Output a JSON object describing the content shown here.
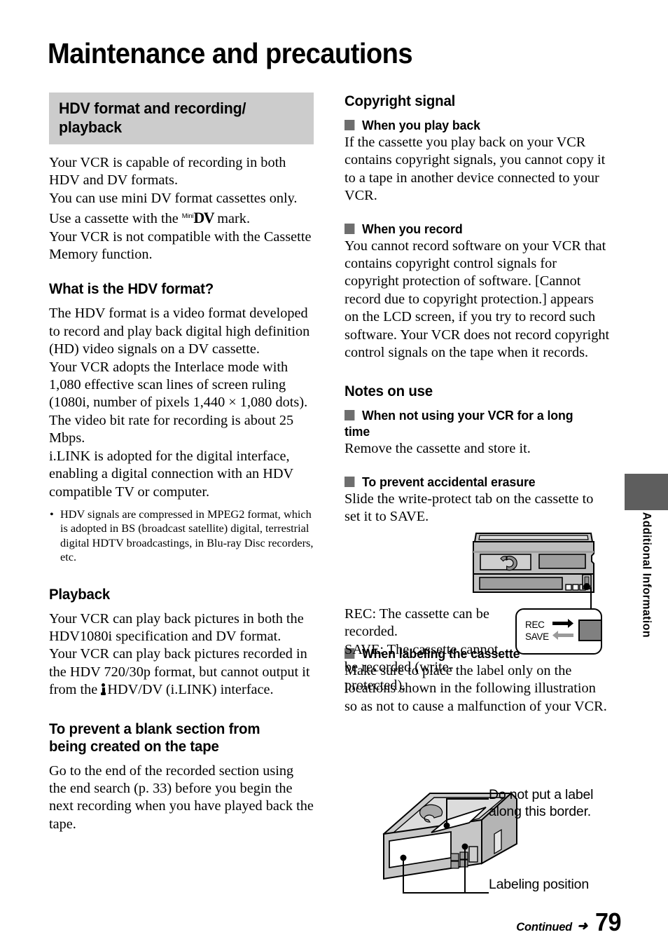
{
  "page": {
    "title": "Maintenance and precautions",
    "number": "79",
    "continued_label": "Continued",
    "continued_arrow": "➜",
    "side_tab_label": "Additional Information"
  },
  "colors": {
    "band_background": "#cccccc",
    "bullet_square": "#6e6e6e",
    "side_tab": "#5e5e5e",
    "cassette_body": "#b8b8b8",
    "cassette_light": "#d6d6d6",
    "cassette_dark": "#9a9a9a",
    "tab_gray": "#808080"
  },
  "left_column": {
    "band_heading": "HDV format and recording/ playback",
    "intro": {
      "line1": "Your VCR is capable of recording in both HDV and DV formats.",
      "line2": "You can use mini DV format cassettes only.",
      "line3_before": "Use a cassette with the ",
      "mini_mark_small": "Mini",
      "mini_mark_big": "DV",
      "line3_after": " mark.",
      "line4": "Your VCR is not compatible with the Cassette Memory function."
    },
    "sections": [
      {
        "heading": "What is the HDV format?",
        "paragraphs": [
          "The HDV format is a video format developed to record and play back digital high definition (HD) video signals on a DV cassette.",
          "Your VCR adopts the Interlace mode with 1,080 effective scan lines of screen ruling (1080i, number of pixels 1,440 × 1,080 dots).",
          "The video bit rate for recording is about 25 Mbps.",
          "i.LINK is adopted for the digital interface, enabling a digital connection with an HDV compatible TV or computer."
        ],
        "bullets": [
          "HDV signals are compressed in MPEG2 format, which is adopted in BS (broadcast satellite) digital, terrestrial digital HDTV broadcastings, in Blu-ray Disc recorders, etc."
        ]
      },
      {
        "heading": "Playback",
        "paragraphs": [
          "Your VCR can play back pictures in both the HDV1080i specification and DV format."
        ],
        "ilink_paragraph": {
          "before": "Your VCR can play back pictures recorded in the HDV 720/30p format, but cannot output it from the ",
          "icon": "ilink-icon",
          "after": "HDV/DV (i.LINK) interface."
        }
      },
      {
        "heading": "To prevent a blank section from being created on the tape",
        "paragraphs": [
          "Go to the end of the recorded section using the end search (p. 33) before you begin the next recording when you have played back the tape."
        ]
      }
    ]
  },
  "right_column": {
    "sections": [
      {
        "heading": "Copyright signal",
        "subsections": [
          {
            "heading": "When you play back",
            "paragraph": "If the cassette you play back on your VCR contains copyright signals, you cannot copy it to a tape in another device connected to your VCR."
          },
          {
            "heading": "When you record",
            "paragraph": "You cannot record software on your VCR that contains copyright control signals for copyright protection of software. [Cannot record due to copyright protection.] appears on the LCD screen, if you try to record such software. Your VCR does not record copyright control signals on the tape when it records."
          }
        ]
      },
      {
        "heading": "Notes on use",
        "subsections": [
          {
            "heading": "When not using your VCR for a long time",
            "paragraph": "Remove the cassette and store it."
          },
          {
            "heading": "To prevent accidental erasure",
            "paragraph": "Slide the write-protect tab on the cassette to set it to SAVE."
          },
          {
            "heading": "When labeling the cassette",
            "paragraph": "Make sure to place the label only on the locations shown in the following illustration so as not to cause a malfunction of your VCR."
          }
        ]
      }
    ],
    "recsave_figure": {
      "caption_rec": "REC: The cassette can be recorded.",
      "caption_save": "SAVE: The cassette cannot be recorded (write-protected).",
      "label_rec": "REC",
      "label_save": "SAVE"
    },
    "labeling_figure": {
      "callout_border": "Do not put a label along this border.",
      "callout_position": "Labeling position"
    }
  }
}
